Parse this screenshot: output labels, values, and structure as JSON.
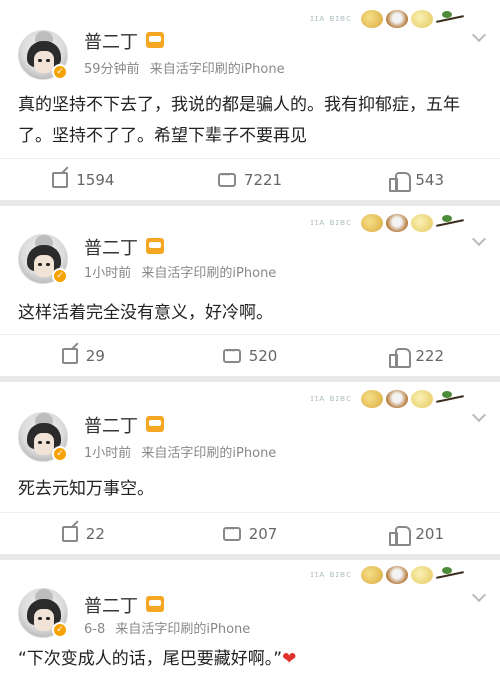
{
  "posts": [
    {
      "user": "普二丁",
      "time": "59分钟前",
      "source": "来自活字印刷的iPhone",
      "text": "真的坚持不下去了，我说的都是骗人的。我有抑郁症，五年了。坚持不了了。希望下辈子不要再见",
      "reposts": "1594",
      "comments": "7221",
      "likes": "543",
      "decor_text": "ɪɪᴀ ʙɪʙᴄ"
    },
    {
      "user": "普二丁",
      "time": "1小时前",
      "source": "来自活字印刷的iPhone",
      "text": "这样活着完全没有意义，好冷啊。",
      "reposts": "29",
      "comments": "520",
      "likes": "222",
      "decor_text": "ɪɪᴀ ʙɪʙᴄ"
    },
    {
      "user": "普二丁",
      "time": "1小时前",
      "source": "来自活字印刷的iPhone",
      "text": "死去元知万事空。",
      "reposts": "22",
      "comments": "207",
      "likes": "201",
      "decor_text": "ɪɪᴀ ʙɪʙᴄ"
    },
    {
      "user": "普二丁",
      "time": "6-8",
      "source": "来自活字印刷的iPhone",
      "text": "“下次变成人的话，尾巴要藏好啊。”",
      "heart": "❤",
      "decor_text": "ɪɪᴀ ʙɪʙᴄ"
    }
  ],
  "icons": {
    "repost": "repost-icon",
    "comment": "comment-icon",
    "like": "like-icon",
    "chevron": "chevron-down-icon"
  },
  "colors": {
    "background": "#e9e9e9",
    "card": "#ffffff",
    "text": "#222222",
    "meta": "#888888",
    "verified": "#f6a300",
    "heart": "#e0322c"
  }
}
